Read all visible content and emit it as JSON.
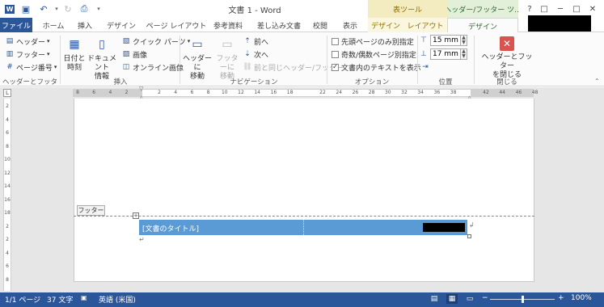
{
  "title_bar": {
    "title": "文書 1 - Word",
    "context_table": "表ツール",
    "context_hf": "ヘッダー/フッター ツ...",
    "qat": [
      "word-logo-icon",
      "save-icon",
      "undo-icon",
      "redo-icon",
      "print-preview-icon"
    ],
    "window_buttons": [
      "?",
      "□",
      "─",
      "□",
      "✕"
    ]
  },
  "tabs": [
    "ファイル",
    "ホーム",
    "挿入",
    "デザイン",
    "ページ レイアウト",
    "参考資料",
    "差し込み文書",
    "校閲",
    "表示",
    "デザイン",
    "レイアウト",
    "デザイン"
  ],
  "ribbon": {
    "hf_group": {
      "header": "ヘッダー",
      "footer": "フッター",
      "page_number": "ページ番号",
      "label": "ヘッダーとフッター"
    },
    "insert_group": {
      "date_time_1": "日付と",
      "date_time_2": "時刻",
      "doc_info_1": "ドキュメント",
      "doc_info_2": "情報",
      "quick_parts": "クイック パーツ",
      "picture": "画像",
      "online_picture": "オンライン画像",
      "label": "挿入"
    },
    "nav_group": {
      "goto_header_1": "ヘッダーに",
      "goto_header_2": "移動",
      "goto_footer_1": "フッターに",
      "goto_footer_2": "移動",
      "previous": "前へ",
      "next": "次へ",
      "link_prev": "前と同じヘッダー/フッター",
      "label": "ナビゲーション"
    },
    "options_group": {
      "diff_first": "先頭ページのみ別指定",
      "diff_odd_even": "奇数/偶数ページ別指定",
      "show_doc_text": "文書内のテキストを表示",
      "diff_first_checked": false,
      "diff_odd_even_checked": false,
      "show_doc_text_checked": true,
      "label": "オプション"
    },
    "position_group": {
      "header_pos": "15 mm",
      "footer_pos": "17 mm",
      "label": "位置"
    },
    "close_group": {
      "close_1": "ヘッダーとフッター",
      "close_2": "を閉じる",
      "label": "閉じる"
    }
  },
  "ruler_ticks": [
    "8",
    "6",
    "4",
    "2",
    "2",
    "4",
    "6",
    "8",
    "10",
    "12",
    "14",
    "16",
    "18",
    "22",
    "24",
    "26",
    "28",
    "30",
    "32",
    "34",
    "36",
    "38",
    "42",
    "44",
    "46",
    "48"
  ],
  "vruler_ticks": [
    "2",
    "4",
    "6",
    "8",
    "10",
    "12",
    "14",
    "16",
    "18",
    "2",
    "2",
    "4",
    "6",
    "8"
  ],
  "document": {
    "footer_tag": "フッター",
    "doc_title_field": "[文書のタイトル]"
  },
  "status_bar": {
    "page": "1/1 ページ",
    "words": "37 文字",
    "language": "英語 (米国)",
    "zoom": "100%",
    "zoom_level_percent": 100
  },
  "colors": {
    "accent": "#2b579a",
    "footer_table": "#5b9bd5",
    "close_button": "#d9534f"
  }
}
